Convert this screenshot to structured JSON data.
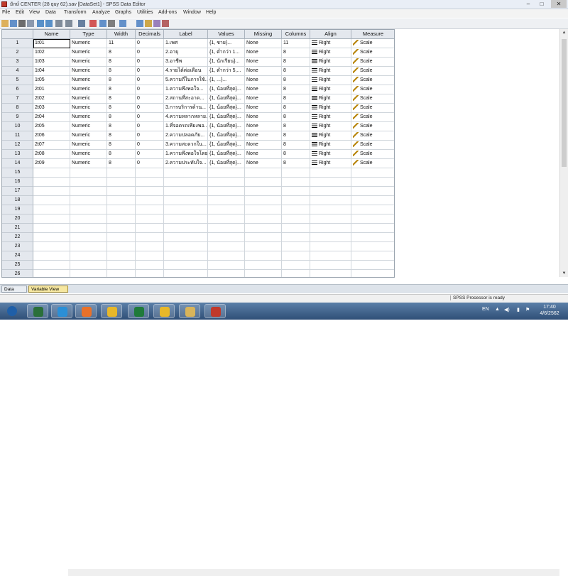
{
  "window": {
    "title": "ยักษ์ CENTER (28 quy 62).sav [DataSet1] - SPSS Data Editor",
    "minimize": "–",
    "maximize": "□",
    "close": "✕"
  },
  "menu": [
    "File",
    "Edit",
    "View",
    "Data",
    "Transform",
    "Analyze",
    "Graphs",
    "Utilities",
    "Add-ons",
    "Window",
    "Help"
  ],
  "toolbar_icons": [
    "open-icon",
    "save-icon",
    "print-icon",
    "dialog-recall-icon",
    "undo-icon",
    "redo-icon",
    "goto-case-icon",
    "variables-icon",
    "find-icon",
    "insert-cases-icon",
    "insert-variable-icon",
    "split-file-icon",
    "weight-cases-icon",
    "select-cases-icon",
    "value-labels-icon",
    "use-sets-icon",
    "show-all-icon"
  ],
  "columns": [
    "Name",
    "Type",
    "Width",
    "Decimals",
    "Label",
    "Values",
    "Missing",
    "Columns",
    "Align",
    "Measure"
  ],
  "rows": [
    {
      "num": "1",
      "name": "1t01",
      "type": "Numeric",
      "width": "11",
      "decimals": "0",
      "label": "1.เพศ",
      "values": "{1, ชาย}...",
      "missing": "None",
      "columns": "11",
      "align": "Right",
      "measure": "Scale"
    },
    {
      "num": "2",
      "name": "1t02",
      "type": "Numeric",
      "width": "8",
      "decimals": "0",
      "label": "2.อายุ",
      "values": "{1, ต่ำกว่า 1...",
      "missing": "None",
      "columns": "8",
      "align": "Right",
      "measure": "Scale"
    },
    {
      "num": "3",
      "name": "1t03",
      "type": "Numeric",
      "width": "8",
      "decimals": "0",
      "label": "3.อาชีพ",
      "values": "{1, นักเรียน}...",
      "missing": "None",
      "columns": "8",
      "align": "Right",
      "measure": "Scale"
    },
    {
      "num": "4",
      "name": "1t04",
      "type": "Numeric",
      "width": "8",
      "decimals": "0",
      "label": "4.รายได้ต่อเดือน",
      "values": "{1, ต่ำกว่า 5,...",
      "missing": "None",
      "columns": "8",
      "align": "Right",
      "measure": "Scale"
    },
    {
      "num": "5",
      "name": "1t05",
      "type": "Numeric",
      "width": "8",
      "decimals": "0",
      "label": "5.ความถี่ในการใช้...",
      "values": "{1, ...}...",
      "missing": "None",
      "columns": "8",
      "align": "Right",
      "measure": "Scale"
    },
    {
      "num": "6",
      "name": "2t01",
      "type": "Numeric",
      "width": "8",
      "decimals": "0",
      "label": "1.ความพึงพอใจ...",
      "values": "{1, น้อยที่สุด}...",
      "missing": "None",
      "columns": "8",
      "align": "Right",
      "measure": "Scale"
    },
    {
      "num": "7",
      "name": "2t02",
      "type": "Numeric",
      "width": "8",
      "decimals": "0",
      "label": "2.สถานที่สะอาด...",
      "values": "{1, น้อยที่สุด}...",
      "missing": "None",
      "columns": "8",
      "align": "Right",
      "measure": "Scale"
    },
    {
      "num": "8",
      "name": "2t03",
      "type": "Numeric",
      "width": "8",
      "decimals": "0",
      "label": "3.การบริการด้าน...",
      "values": "{1, น้อยที่สุด}...",
      "missing": "None",
      "columns": "8",
      "align": "Right",
      "measure": "Scale"
    },
    {
      "num": "9",
      "name": "2t04",
      "type": "Numeric",
      "width": "8",
      "decimals": "0",
      "label": "4.ความหลากหลาย...",
      "values": "{1, น้อยที่สุด}...",
      "missing": "None",
      "columns": "8",
      "align": "Right",
      "measure": "Scale"
    },
    {
      "num": "10",
      "name": "2t05",
      "type": "Numeric",
      "width": "8",
      "decimals": "0",
      "label": "1.ที่จอดรถเพียงพอ...",
      "values": "{1, น้อยที่สุด}...",
      "missing": "None",
      "columns": "8",
      "align": "Right",
      "measure": "Scale"
    },
    {
      "num": "11",
      "name": "2t06",
      "type": "Numeric",
      "width": "8",
      "decimals": "0",
      "label": "2.ความปลอดภัย...",
      "values": "{1, น้อยที่สุด}...",
      "missing": "None",
      "columns": "8",
      "align": "Right",
      "measure": "Scale"
    },
    {
      "num": "12",
      "name": "2t07",
      "type": "Numeric",
      "width": "8",
      "decimals": "0",
      "label": "3.ความสะดวกใน...",
      "values": "{1, น้อยที่สุด}...",
      "missing": "None",
      "columns": "8",
      "align": "Right",
      "measure": "Scale"
    },
    {
      "num": "13",
      "name": "2t08",
      "type": "Numeric",
      "width": "8",
      "decimals": "0",
      "label": "1.ความพึงพอใจโดย...",
      "values": "{1, น้อยที่สุด}...",
      "missing": "None",
      "columns": "8",
      "align": "Right",
      "measure": "Scale"
    },
    {
      "num": "14",
      "name": "2t09",
      "type": "Numeric",
      "width": "8",
      "decimals": "0",
      "label": "2.ความประทับใจ...",
      "values": "{1, น้อยที่สุด}...",
      "missing": "None",
      "columns": "8",
      "align": "Right",
      "measure": "Scale"
    }
  ],
  "empty_row_numbers": [
    "15",
    "16",
    "17",
    "18",
    "19",
    "20",
    "21",
    "22",
    "23",
    "24",
    "25",
    "26"
  ],
  "tabs": {
    "data_view": "Data View",
    "variable_view": "Variable View"
  },
  "status": "SPSS Processor is ready",
  "taskbar": {
    "apps": [
      "start-orb-icon",
      "media-player-icon",
      "internet-explorer-icon",
      "firefox-icon",
      "chrome-icon",
      "excel-icon",
      "chrome-alt-icon",
      "file-explorer-icon",
      "spss-icon"
    ],
    "lang": "EN",
    "time": "17:40",
    "date": "4/6/2562"
  },
  "colors": {
    "accent": "#f6e7a0",
    "header_bg": "#e4e8ee",
    "taskbar": "#2f4f77"
  }
}
